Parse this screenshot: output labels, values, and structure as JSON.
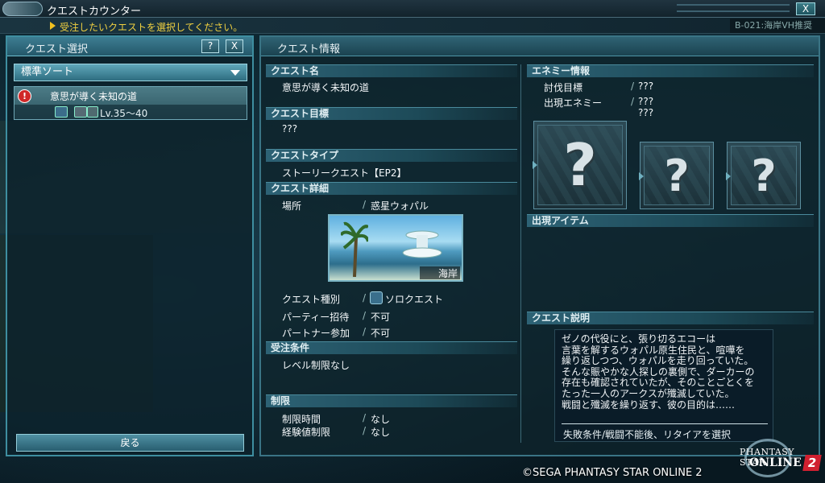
{
  "window": {
    "title": "クエストカウンター",
    "close": "X"
  },
  "instruction": "受注したいクエストを選択してください。",
  "block_badge": "B-021:海岸VH推奨",
  "left": {
    "title": "クエスト選択",
    "help": "?",
    "close": "X",
    "sort_label": "標準ソート",
    "quests": [
      {
        "name": "意思が導く未知の道",
        "level": "Lv.35〜40",
        "alert": "!"
      }
    ],
    "back_label": "戻る"
  },
  "right": {
    "title": "クエスト情報",
    "quest_name_h": "クエスト名",
    "quest_name": "意思が導く未知の道",
    "target_h": "クエスト目標",
    "target": "???",
    "type_h": "クエストタイプ",
    "type": "ストーリークエスト【EP2】",
    "detail_h": "クエスト詳細",
    "place_label": "場所",
    "place": "惑星ウォパル",
    "area_caption": "海岸",
    "kind_label": "クエスト種別",
    "kind": "ソロクエスト",
    "party_label": "パーティー招待",
    "party": "不可",
    "partner_label": "パートナー参加",
    "partner": "不可",
    "cond_h": "受注条件",
    "cond": "レベル制限なし",
    "limit_h": "制限",
    "time_label": "制限時間",
    "time": "なし",
    "exp_label": "経験値制限",
    "exp": "なし",
    "slash": "/",
    "enemy_h": "エネミー情報",
    "defeat_label": "討伐目標",
    "defeat": "???",
    "appear_label": "出現エネミー",
    "appear1": "???",
    "appear2": "???",
    "unknown": "?",
    "item_h": "出現アイテム",
    "desc_h": "クエスト説明",
    "desc_lines": [
      "ゼノの代役にと、張り切るエコーは",
      "言葉を解するウォパル原生住民と、喧嘩を",
      "繰り返しつつ、ウォパルを走り回っていた。",
      "そんな賑やかな人探しの裏側で、ダーカーの",
      "存在も確認されていたが、そのことごとくを",
      "たった一人のアークスが殲滅していた。",
      "戦闘と殲滅を繰り返す、彼の目的は……"
    ],
    "fail": "失敗条件/戦闘不能後、リタイアを選択"
  },
  "footer": {
    "copyright": "©SEGA PHANTASY STAR ONLINE 2",
    "logo_top": "PHANTASY STAR",
    "logo_main": "ONLINE",
    "logo_num": "2"
  }
}
